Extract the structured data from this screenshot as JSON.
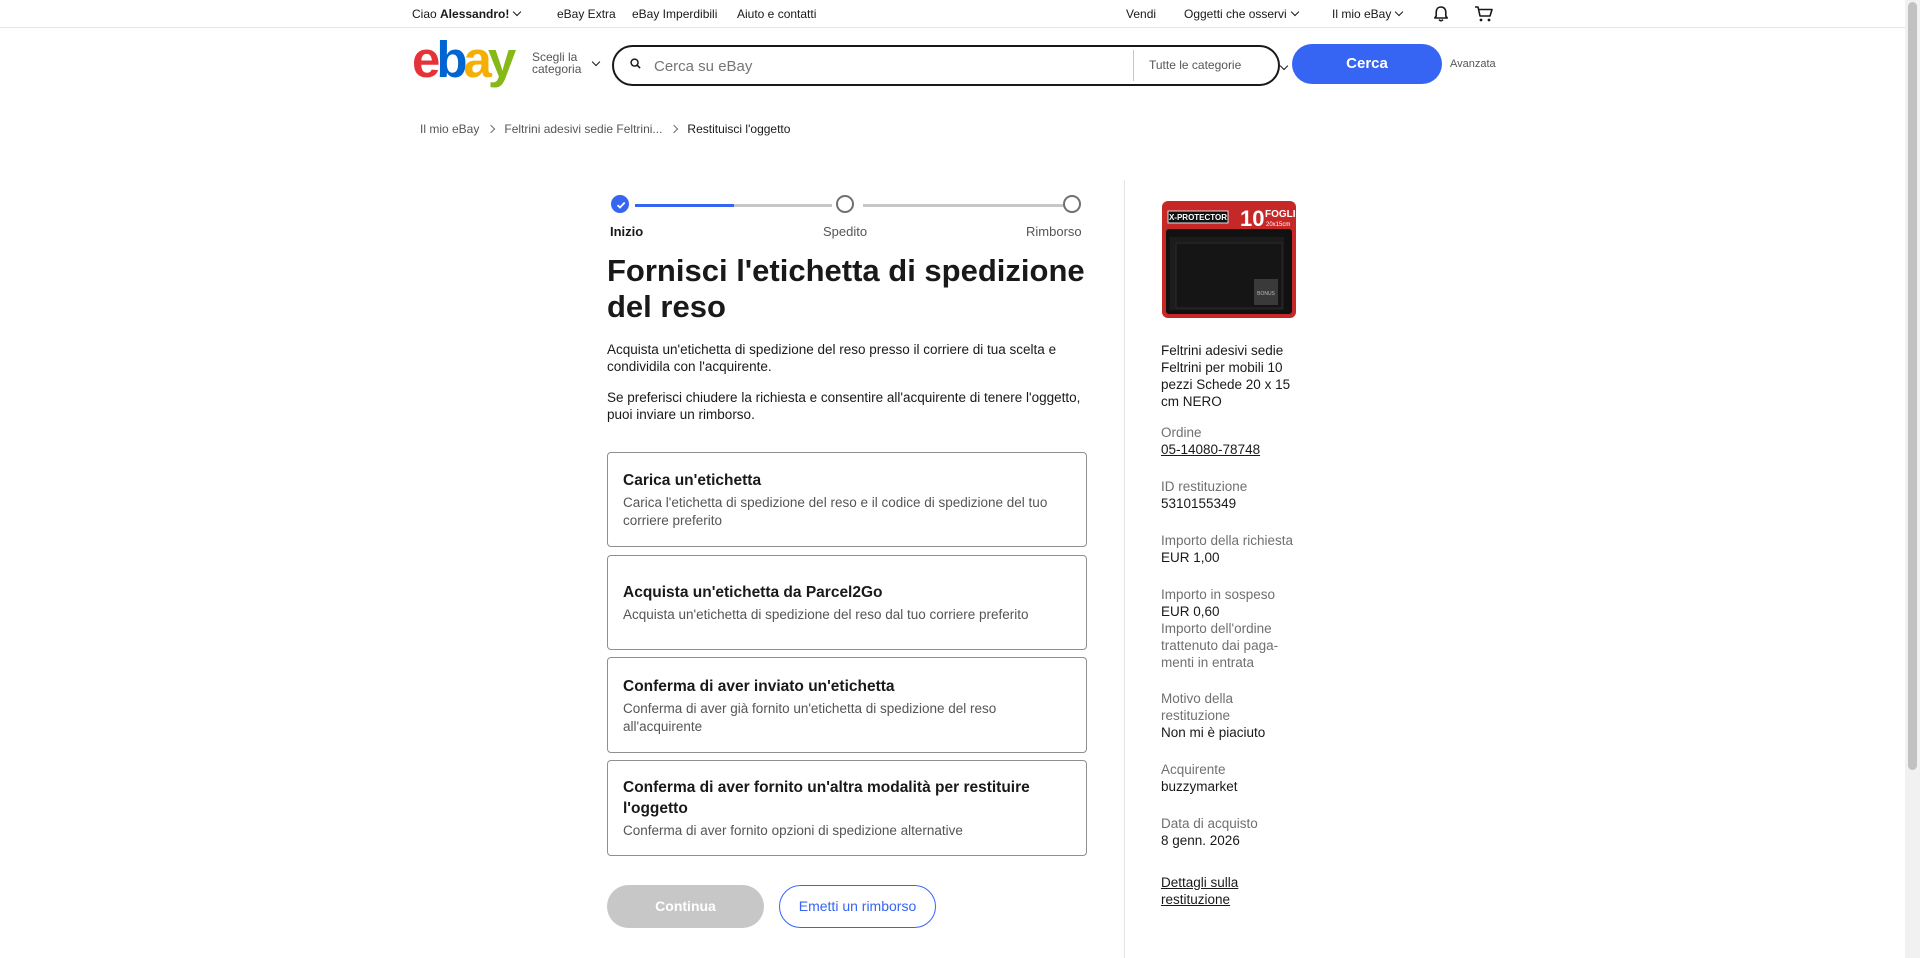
{
  "topnav": {
    "greeting_prefix": "Ciao ",
    "greeting_name": "Alessandro!",
    "links": [
      "eBay Extra",
      "eBay Imperdibili",
      "Aiuto e contatti"
    ],
    "sell": "Vendi",
    "watchlist": "Oggetti che osservi",
    "my_ebay": "Il mio eBay"
  },
  "header": {
    "logo_letters": [
      "e",
      "b",
      "a",
      "y"
    ],
    "shop_category_line1": "Scegli la",
    "shop_category_line2": "categoria",
    "search_placeholder": "Cerca su eBay",
    "categories_select": "Tutte le categorie",
    "search_button": "Cerca",
    "advanced": "Avanzata"
  },
  "breadcrumb": [
    "Il mio eBay",
    "Feltrini adesivi sedie Feltrini...",
    "Restituisci l'oggetto"
  ],
  "progress": {
    "steps": [
      "Inizio",
      "Spedito",
      "Rimborso"
    ],
    "current_step": 1,
    "fill_fraction": 0.5
  },
  "main": {
    "title": "Fornisci l'etichetta di spedizione del reso",
    "para1": "Acquista un'etichetta di spedizione del reso presso il corriere di tua scelta e condividila con l'acquirente.",
    "para2": "Se preferisci chiudere la richiesta e consentire all'acquirente di tenere l'oggetto, puoi inviare un rimborso.",
    "options": [
      {
        "title": "Carica un'etichetta",
        "desc": "Carica l'etichetta di spedizione del reso e il codice di spedizione del tuo corriere preferito"
      },
      {
        "title": "Acquista un'etichetta da Parcel2Go",
        "desc": "Acquista un'etichetta di spedizione del reso dal tuo corriere preferito"
      },
      {
        "title": "Conferma di aver inviato un'etichetta",
        "desc": "Conferma di aver già fornito un'etichetta di spedizione del reso all'acquirente"
      },
      {
        "title": "Conferma di aver fornito un'altra modalità per restituire l'oggetto",
        "desc": "Conferma di aver fornito opzioni di spedizione alternative"
      }
    ],
    "continue_button": "Continua",
    "refund_button": "Emetti un rimborso"
  },
  "product_image": {
    "brand": "X-PROTECTOR",
    "count": "10",
    "unit": "FOGLI",
    "size": "20x15cm",
    "badge": "BONUS"
  },
  "sidebar": {
    "product_title": "Feltrini adesivi sedie Feltrini per mobili 10 pezzi Schede 20 x 15 cm NERO",
    "order_label": "Ordine",
    "order_value": "05-14080-78748",
    "return_id_label": "ID restituzione",
    "return_id_value": "5310155349",
    "requested_label": "Importo della richiesta",
    "requested_value": "EUR 1,00",
    "pending_label": "Importo in sospeso",
    "pending_value": "EUR 0,60",
    "pending_note": "Importo dell'ordine trattenuto dai paga-menti in entrata",
    "reason_label": "Motivo della restituzione",
    "reason_value": "Non mi è piaciuto",
    "buyer_label": "Acquirente",
    "buyer_value": "buzzymarket",
    "purchase_date_label": "Data di acquisto",
    "purchase_date_value": "8 genn. 2026",
    "details_link": "Dettagli sulla restituzione"
  },
  "colors": {
    "accent": "#3665f3",
    "logo_red": "#e53238",
    "logo_blue": "#0064d2",
    "logo_yellow": "#f5af02",
    "logo_green": "#86b817"
  }
}
